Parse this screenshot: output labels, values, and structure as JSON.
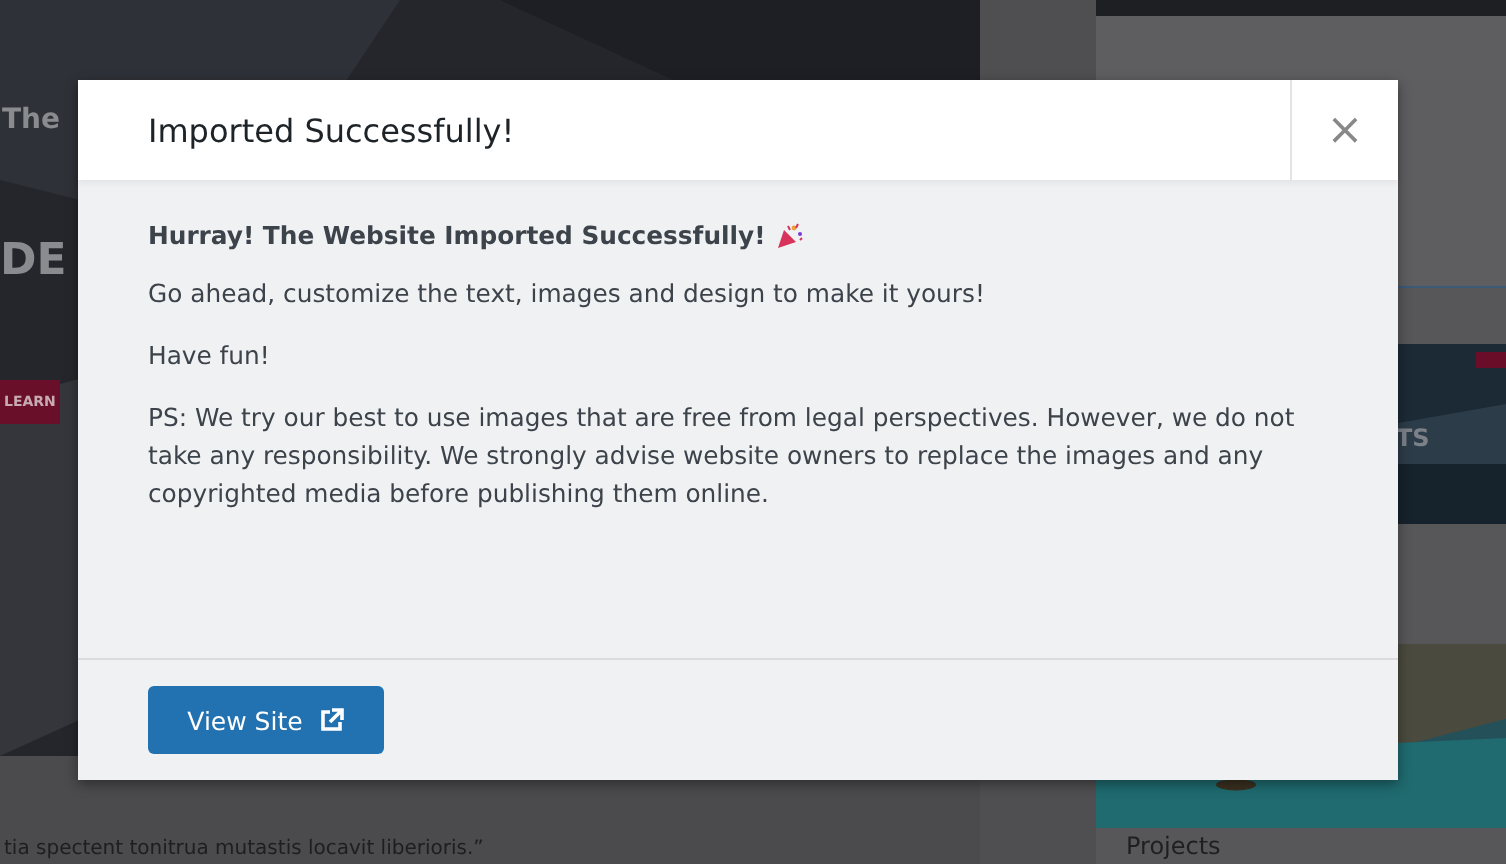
{
  "background": {
    "hero_heading": "The",
    "hero_title": "DE",
    "hero_button": "LEARN",
    "quote": "tia spectent tonitrua mutastis locavit liberioris.”",
    "sidebar_caption": "TS",
    "sidebar_heading": "Projects"
  },
  "dialog": {
    "title": "Imported Successfully!",
    "close": "×",
    "headline": "Hurray! The Website Imported Successfully!",
    "paragraphs": [
      "Go ahead, customize the text, images and design to make it yours!",
      "Have fun!",
      "PS: We try our best to use images that are free from legal perspectives. However, we do not take any responsibility. We strongly advise website owners to replace the images and any copyrighted media before publishing them online."
    ],
    "button": "View Site"
  }
}
